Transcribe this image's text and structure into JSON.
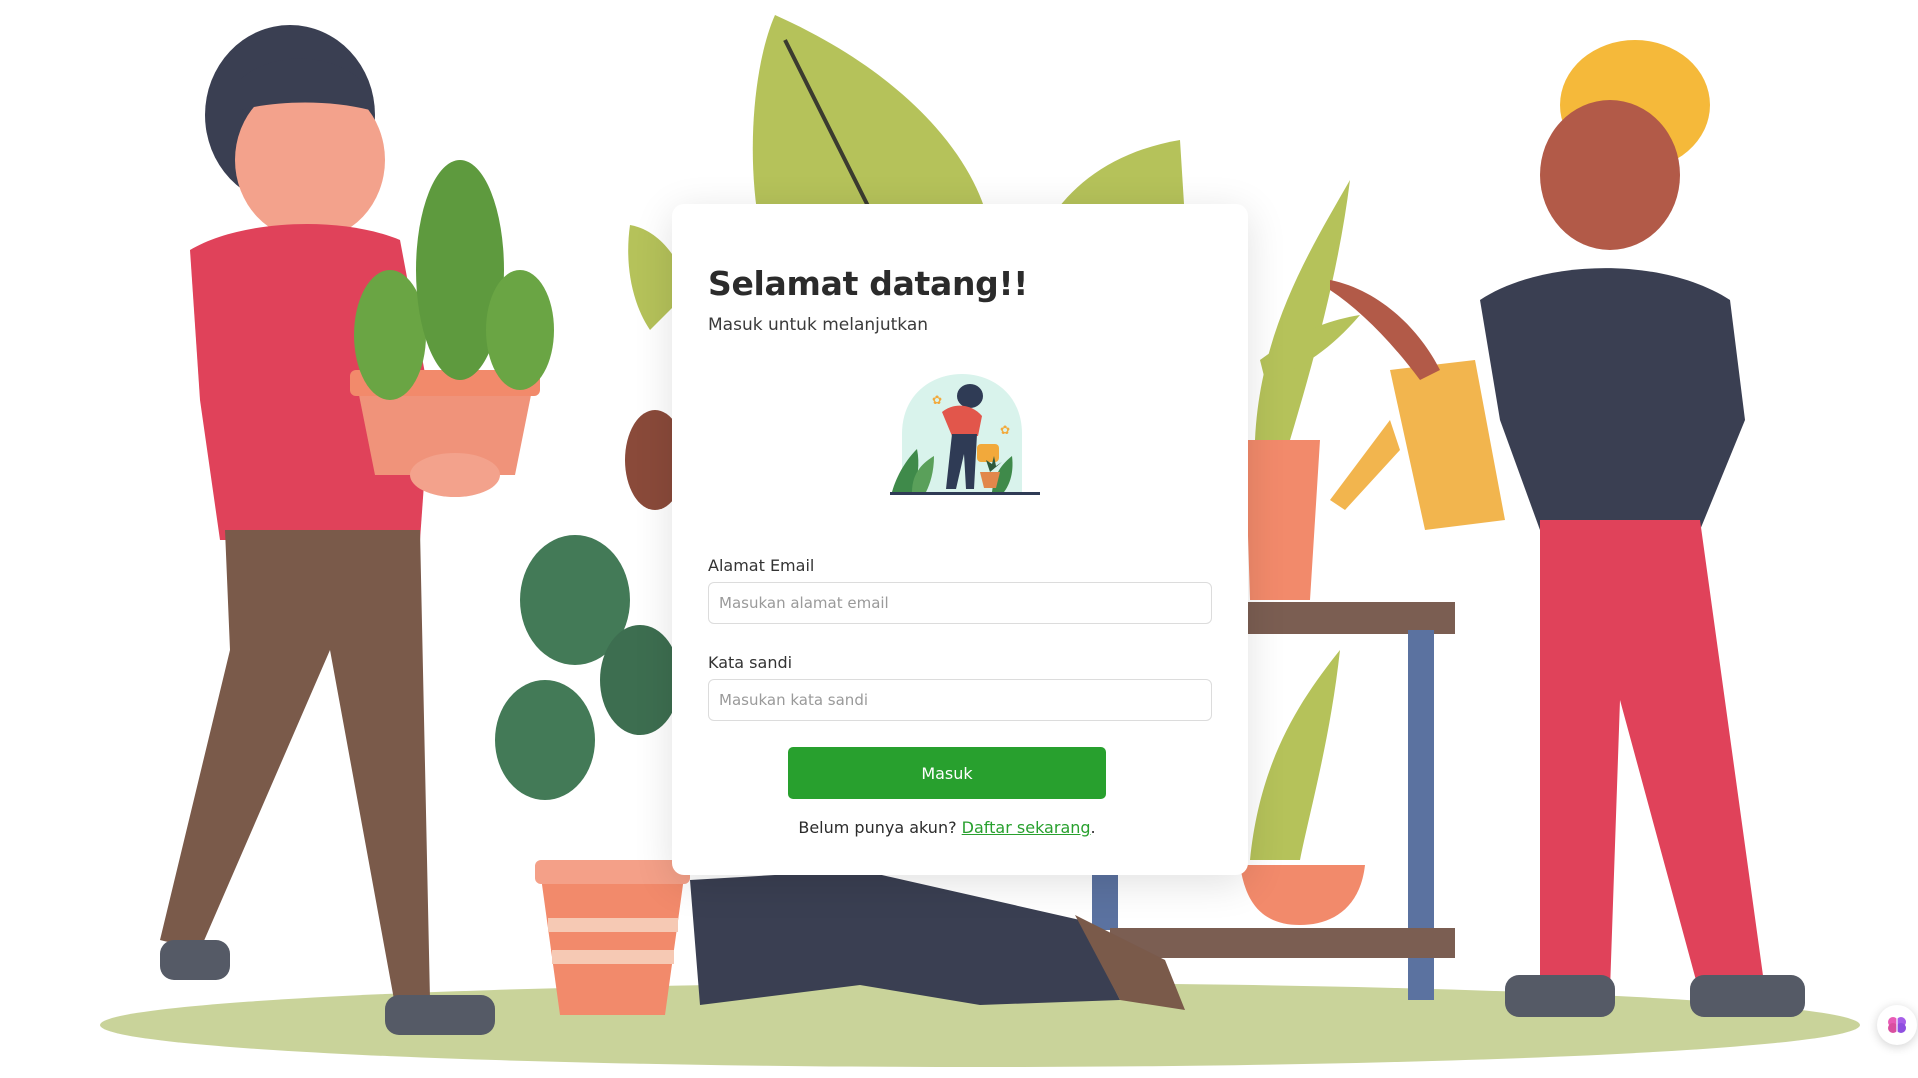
{
  "login": {
    "title": "Selamat datang!!",
    "subtitle": "Masuk untuk melanjutkan",
    "email_label": "Alamat Email",
    "email_placeholder": "Masukan alamat email",
    "password_label": "Kata sandi",
    "password_placeholder": "Masukan kata sandi",
    "submit_label": "Masuk",
    "register_prompt": "Belum punya akun?",
    "register_link": "Daftar sekarang",
    "register_suffix": "."
  },
  "icons": {
    "header_illustration": "gardener-watering-plants-icon",
    "floating_button": "brain-icon"
  },
  "colors": {
    "primary": "#28a02e",
    "ground": "#c9d39a",
    "leaf": "#b5c25a"
  }
}
